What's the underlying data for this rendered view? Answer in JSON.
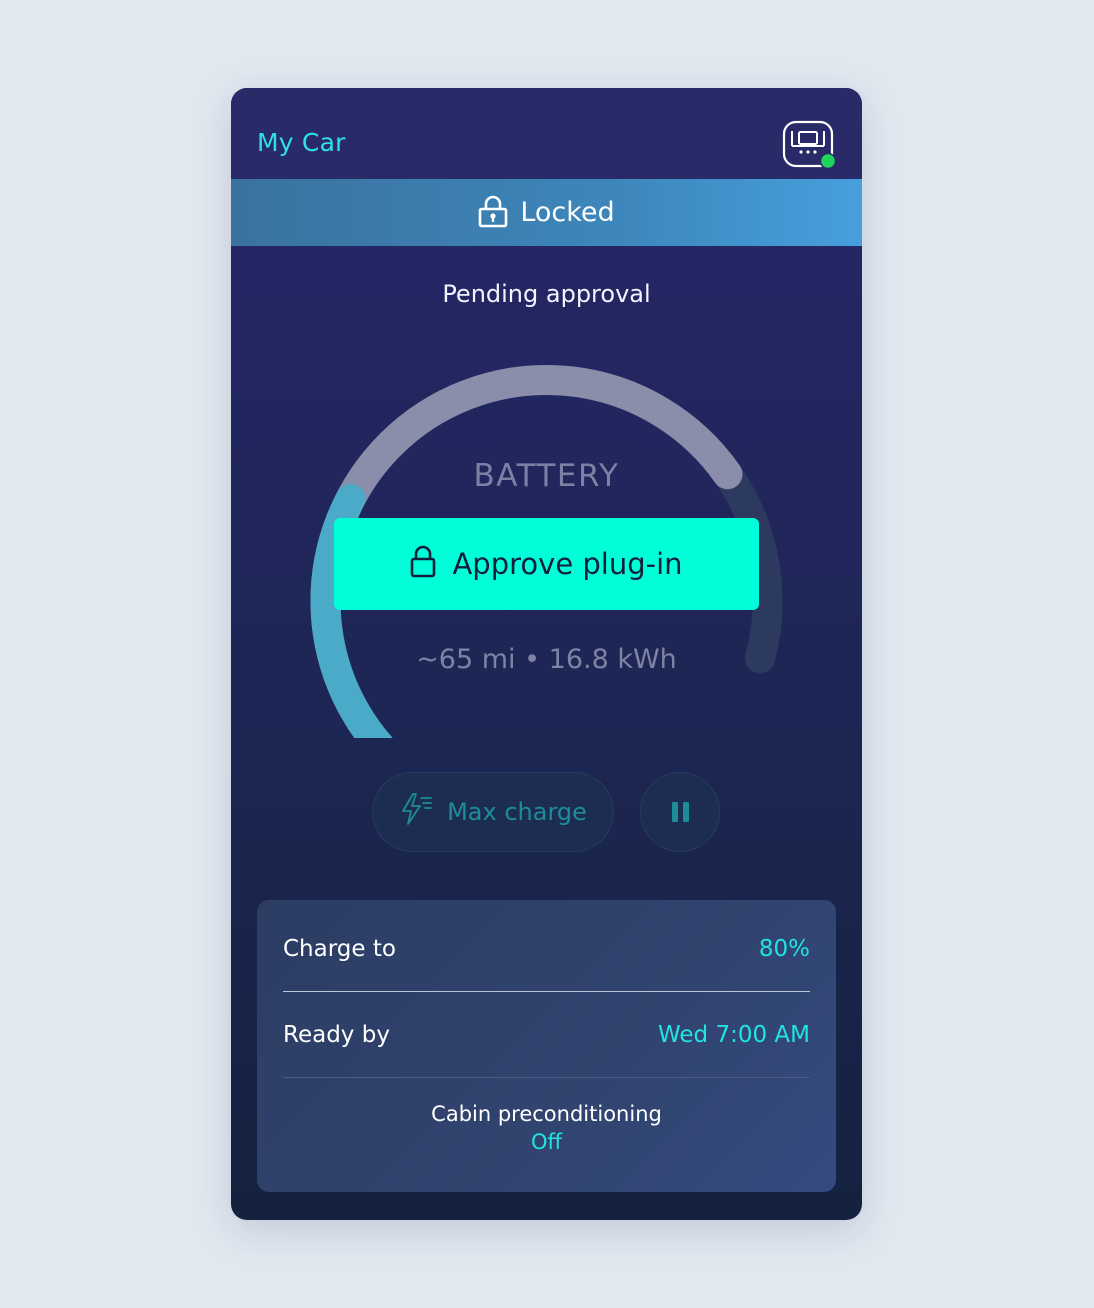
{
  "header": {
    "title": "My Car"
  },
  "lock_banner": {
    "label": "Locked"
  },
  "status": {
    "text": "Pending approval"
  },
  "gauge": {
    "label": "BATTERY",
    "charge_level": 0.33,
    "target_level": 0.8,
    "range_text": "~65 mi • 16.8 kWh"
  },
  "approve_button": {
    "label": "Approve plug-in"
  },
  "controls": {
    "max_charge_label": "Max charge"
  },
  "settings": {
    "charge_to": {
      "label": "Charge to",
      "value": "80%"
    },
    "ready_by": {
      "label": "Ready by",
      "value": "Wed 7:00 AM"
    },
    "cabin": {
      "label": "Cabin preconditioning",
      "value": "Off"
    }
  },
  "colors": {
    "accent": "#00ffd8",
    "accent_text": "#2de1e8",
    "charge_arc": "#4aaac8",
    "target_arc": "#8a8eab",
    "online_dot": "#1fd65a"
  },
  "icons": {
    "charger": "ev-charger-icon",
    "lock": "padlock-icon",
    "bolt": "lightning-bolt-icon",
    "pause": "pause-icon"
  }
}
